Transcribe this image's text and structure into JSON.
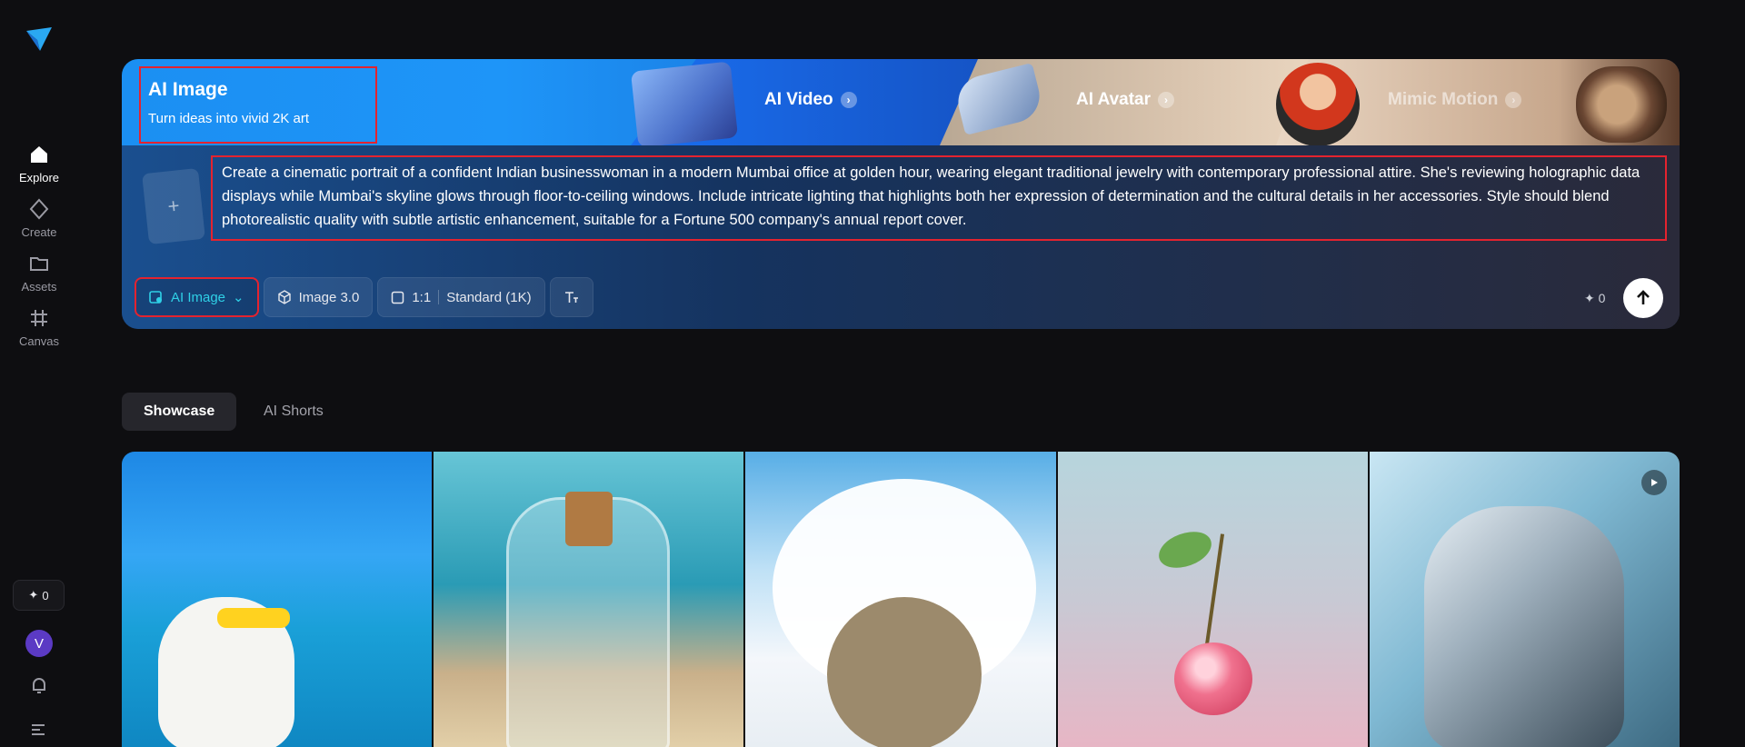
{
  "sidebar": {
    "items": [
      {
        "label": "Explore",
        "icon": "home-icon"
      },
      {
        "label": "Create",
        "icon": "diamond-icon"
      },
      {
        "label": "Assets",
        "icon": "folder-icon"
      },
      {
        "label": "Canvas",
        "icon": "crop-icon"
      }
    ],
    "credits": "0",
    "avatar_initial": "V"
  },
  "hero": {
    "title": "AI Image",
    "subtitle": "Turn ideas into vivid 2K art",
    "tabs": [
      {
        "label": "AI Video"
      },
      {
        "label": "AI Avatar"
      },
      {
        "label": "Mimic Motion"
      }
    ],
    "upload_symbol": "+",
    "prompt": "Create a cinematic portrait of a confident Indian businesswoman in a modern Mumbai office at golden hour, wearing elegant traditional jewelry with contemporary professional attire. She's reviewing holographic data displays while Mumbai's skyline glows through floor-to-ceiling windows. Include intricate lighting that highlights both her expression of determination and the cultural details in her accessories. Style should blend photorealistic quality with subtle artistic enhancement, suitable for a Fortune 500 company's annual report cover.",
    "toolbar": {
      "mode": "AI Image",
      "model": "Image 3.0",
      "ratio": "1:1",
      "quality": "Standard (1K)"
    },
    "cost": "0"
  },
  "feed": {
    "tabs": [
      {
        "label": "Showcase",
        "active": true
      },
      {
        "label": "AI Shorts",
        "active": false
      }
    ]
  },
  "colors": {
    "accent": "#2fd0e6",
    "highlight": "#e4232f",
    "background": "#0e0e11",
    "avatar": "#5b3ac4"
  }
}
